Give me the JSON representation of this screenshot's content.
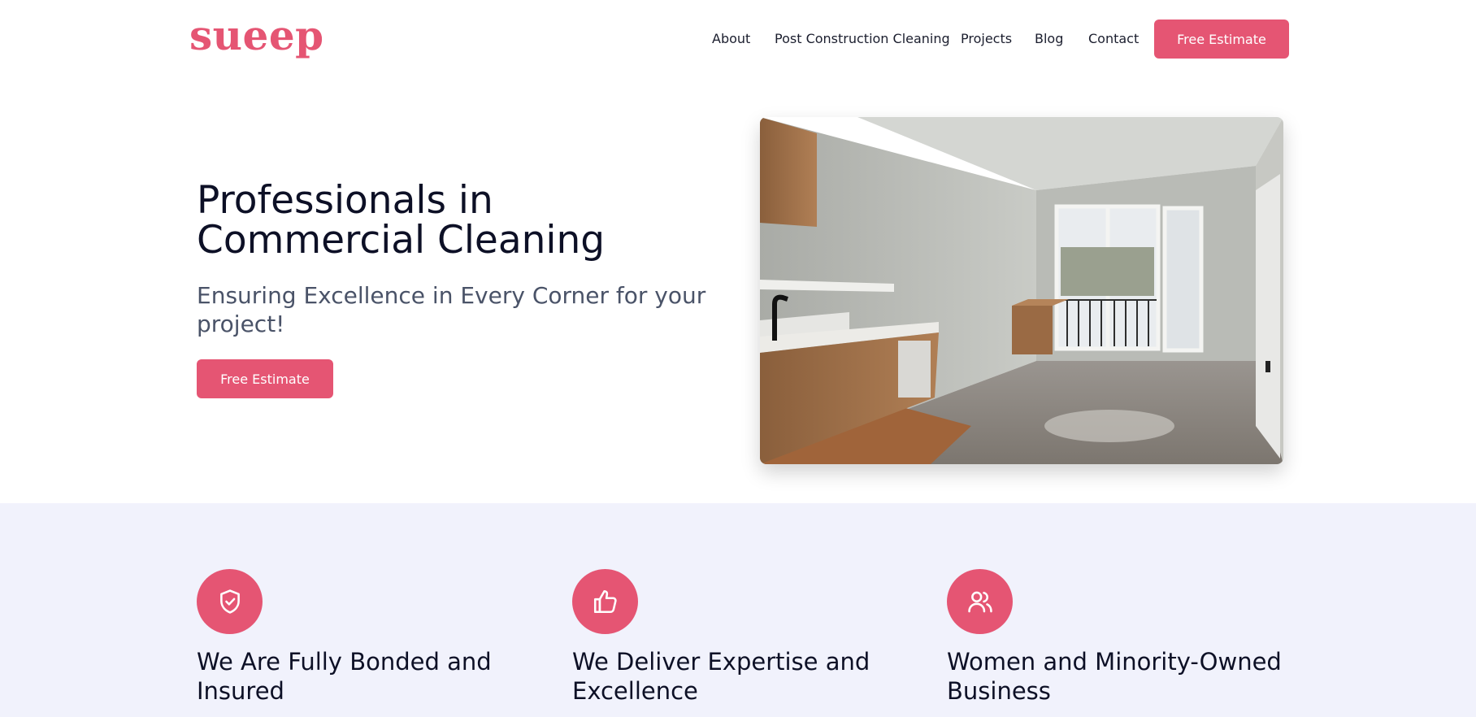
{
  "brand": {
    "logo_text": "sueep",
    "accent_color": "#e55573"
  },
  "nav": {
    "items": [
      "About",
      "Post Construction Cleaning",
      "Projects",
      "Blog",
      "Contact"
    ],
    "cta_label": "Free Estimate"
  },
  "hero": {
    "title": "Professionals in Commercial Cleaning",
    "subtitle": "Ensuring Excellence in Every Corner for your project!",
    "cta_label": "Free Estimate",
    "image": "photo of an empty apartment room with kitchen cabinets, sink, window door to a balcony and a cardboard box"
  },
  "features": [
    {
      "icon": "shield-check-icon",
      "title": "We Are Fully Bonded and Insured"
    },
    {
      "icon": "thumbs-up-icon",
      "title": "We Deliver Expertise and Excellence"
    },
    {
      "icon": "users-icon",
      "title": "Women and Minority-Owned Business"
    }
  ]
}
